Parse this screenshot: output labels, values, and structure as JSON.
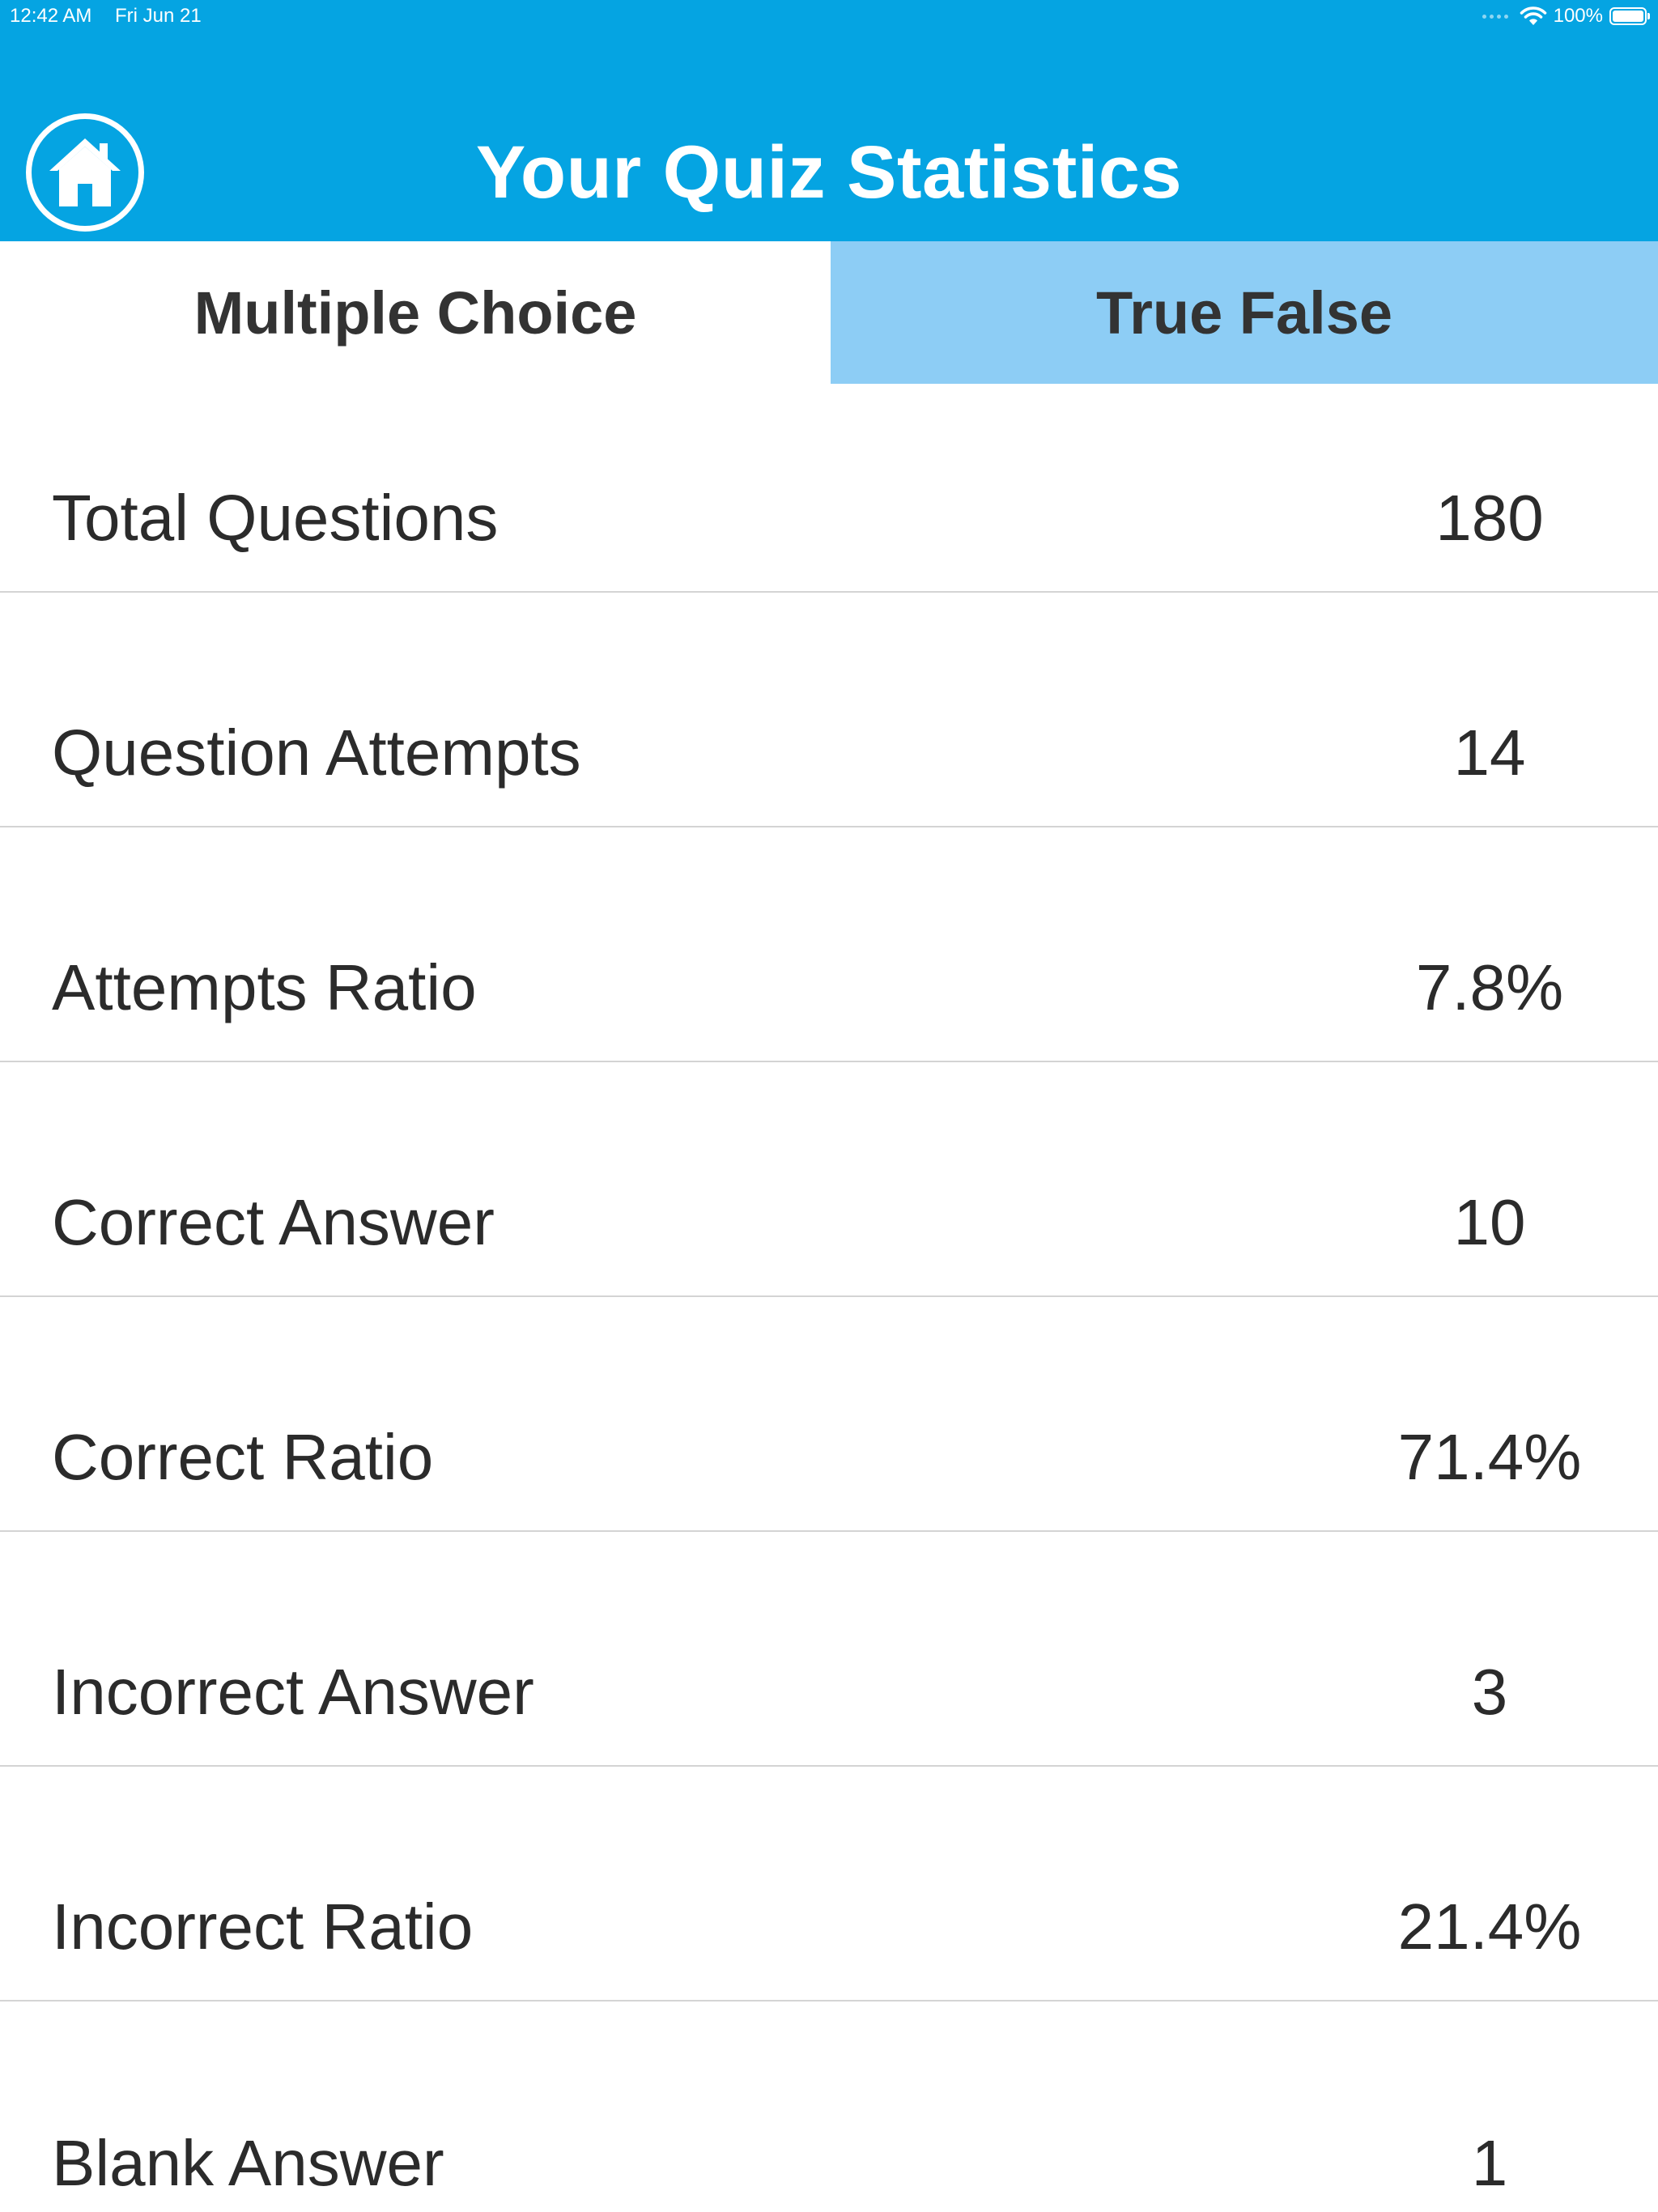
{
  "status_bar": {
    "time": "12:42 AM",
    "date": "Fri Jun 21",
    "battery": "100%"
  },
  "header": {
    "title": "Your Quiz Statistics",
    "home_icon": "home-icon",
    "background": "#05a4e2"
  },
  "tabs": [
    {
      "label": "Multiple Choice",
      "selected": true
    },
    {
      "label": "True False",
      "selected": false
    }
  ],
  "stats": [
    {
      "label": "Total Questions",
      "value": "180"
    },
    {
      "label": "Question Attempts",
      "value": "14"
    },
    {
      "label": "Attempts Ratio",
      "value": "7.8%"
    },
    {
      "label": "Correct Answer",
      "value": "10"
    },
    {
      "label": "Correct Ratio",
      "value": "71.4%"
    },
    {
      "label": "Incorrect Answer",
      "value": "3"
    },
    {
      "label": "Incorrect Ratio",
      "value": "21.4%"
    },
    {
      "label": "Blank Answer",
      "value": "1"
    }
  ]
}
